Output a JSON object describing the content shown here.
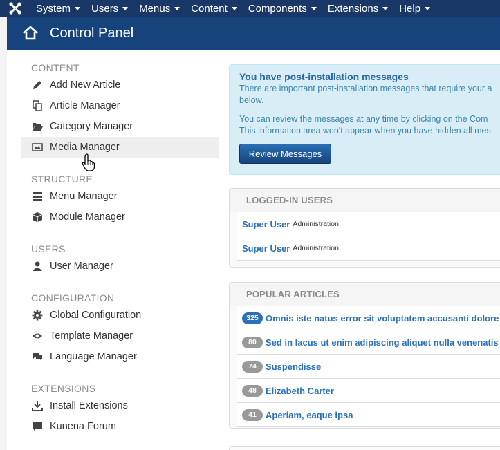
{
  "topnav": {
    "items": [
      {
        "label": "System"
      },
      {
        "label": "Users"
      },
      {
        "label": "Menus"
      },
      {
        "label": "Content"
      },
      {
        "label": "Components"
      },
      {
        "label": "Extensions"
      },
      {
        "label": "Help"
      }
    ]
  },
  "header": {
    "title": "Control Panel"
  },
  "sidebar": {
    "sections": [
      {
        "title": "CONTENT",
        "items": [
          {
            "label": "Add New Article",
            "icon": "pencil-icon"
          },
          {
            "label": "Article Manager",
            "icon": "copy-icon"
          },
          {
            "label": "Category Manager",
            "icon": "folder-open-icon"
          },
          {
            "label": "Media Manager",
            "icon": "image-icon"
          }
        ]
      },
      {
        "title": "STRUCTURE",
        "items": [
          {
            "label": "Menu Manager",
            "icon": "list-icon"
          },
          {
            "label": "Module Manager",
            "icon": "cube-icon"
          }
        ]
      },
      {
        "title": "USERS",
        "items": [
          {
            "label": "User Manager",
            "icon": "user-icon"
          }
        ]
      },
      {
        "title": "CONFIGURATION",
        "items": [
          {
            "label": "Global Configuration",
            "icon": "gear-icon"
          },
          {
            "label": "Template Manager",
            "icon": "eye-icon"
          },
          {
            "label": "Language Manager",
            "icon": "comments-icon"
          }
        ]
      },
      {
        "title": "EXTENSIONS",
        "items": [
          {
            "label": "Install Extensions",
            "icon": "download-icon"
          },
          {
            "label": "Kunena Forum",
            "icon": "comment-icon"
          }
        ]
      }
    ]
  },
  "alert": {
    "title": "You have post-installation messages",
    "line1": "There are important post-installation messages that require your a",
    "line2": "below.",
    "line3": "You can review the messages at any time by clicking on the Com",
    "line4": "This information area won't appear when you have hidden all mes",
    "button": "Review Messages"
  },
  "logged_in": {
    "title": "LOGGED-IN USERS",
    "rows": [
      {
        "name": "Super User",
        "area": "Administration"
      },
      {
        "name": "Super User",
        "area": "Administration"
      }
    ]
  },
  "popular": {
    "title": "POPULAR ARTICLES",
    "rows": [
      {
        "hits": "325",
        "title": "Omnis iste natus error sit voluptatem accusanti dolore"
      },
      {
        "hits": "80",
        "title": "Sed in lacus ut enim adipiscing aliquet nulla venenatis"
      },
      {
        "hits": "74",
        "title": "Suspendisse"
      },
      {
        "hits": "48",
        "title": "Elizabeth Carter"
      },
      {
        "hits": "41",
        "title": "Aperiam, eaque ipsa"
      }
    ]
  },
  "colors": {
    "topbar": "#1a3867",
    "header": "#17437c",
    "link": "#2a70b8",
    "alert_bg": "#d9edf7"
  }
}
